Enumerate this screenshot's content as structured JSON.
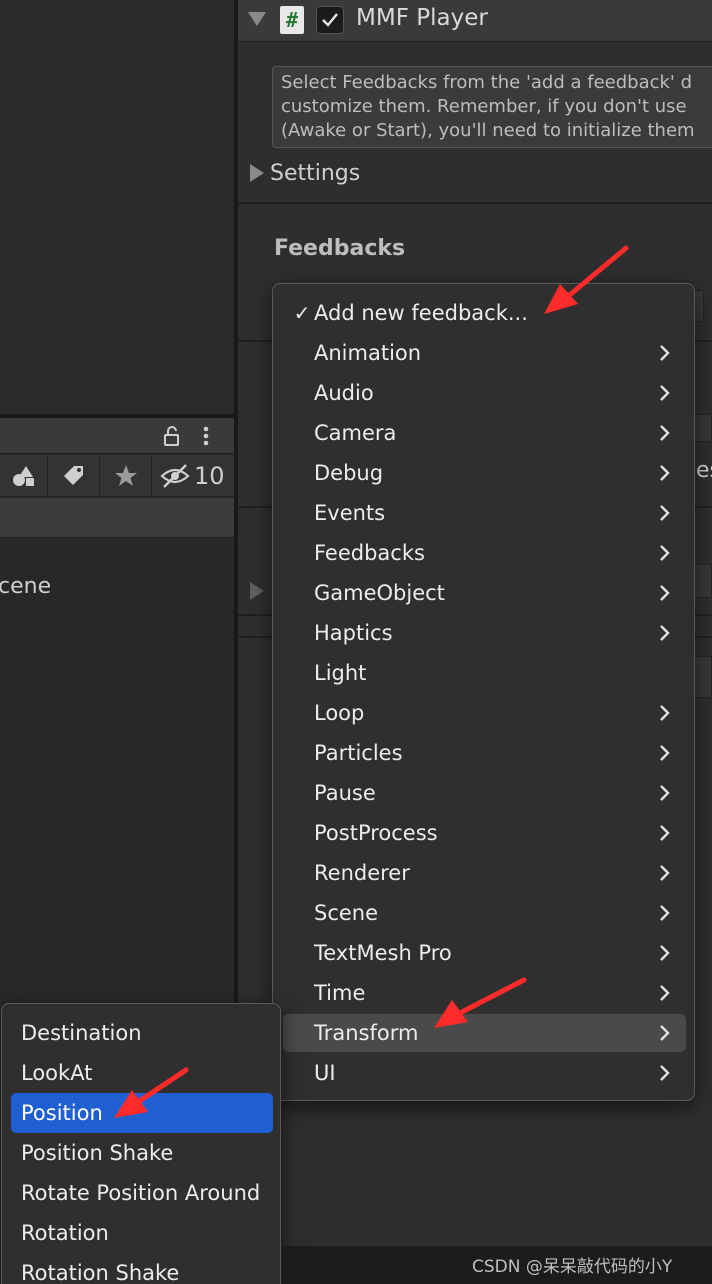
{
  "inspector": {
    "component_title": "MMF Player",
    "help_lines": [
      "Select Feedbacks from the 'add a feedback' d",
      "customize them. Remember, if you don't use",
      "(Awake or Start), you'll need to initialize them"
    ],
    "settings_label": "Settings",
    "feedbacks_label": "Feedbacks"
  },
  "hierarchy": {
    "hidden_count": "10",
    "scene_label": "cene"
  },
  "menu": {
    "items": [
      {
        "label": "Add new feedback...",
        "checked": true,
        "submenu": false
      },
      {
        "label": "Animation",
        "submenu": true
      },
      {
        "label": "Audio",
        "submenu": true
      },
      {
        "label": "Camera",
        "submenu": true
      },
      {
        "label": "Debug",
        "submenu": true
      },
      {
        "label": "Events",
        "submenu": true
      },
      {
        "label": "Feedbacks",
        "submenu": true
      },
      {
        "label": "GameObject",
        "submenu": true
      },
      {
        "label": "Haptics",
        "submenu": true
      },
      {
        "label": "Light",
        "submenu": false
      },
      {
        "label": "Loop",
        "submenu": true
      },
      {
        "label": "Particles",
        "submenu": true
      },
      {
        "label": "Pause",
        "submenu": true
      },
      {
        "label": "PostProcess",
        "submenu": true
      },
      {
        "label": "Renderer",
        "submenu": true
      },
      {
        "label": "Scene",
        "submenu": true
      },
      {
        "label": "TextMesh Pro",
        "submenu": true
      },
      {
        "label": "Time",
        "submenu": true
      },
      {
        "label": "Transform",
        "submenu": true,
        "highlighted": true
      },
      {
        "label": "UI",
        "submenu": true
      }
    ],
    "check_mark": "✓"
  },
  "submenu": {
    "items": [
      {
        "label": "Destination"
      },
      {
        "label": "LookAt"
      },
      {
        "label": "Position",
        "selected": true
      },
      {
        "label": "Position Shake"
      },
      {
        "label": "Rotate Position Around"
      },
      {
        "label": "Rotation"
      },
      {
        "label": "Rotation Shake"
      }
    ]
  },
  "watermark": "CSDN @呆呆敲代码的小Y",
  "colors": {
    "selection": "#1f5fd1",
    "highlight": "#4a4a4a",
    "annotation": "#ff2a2a"
  }
}
